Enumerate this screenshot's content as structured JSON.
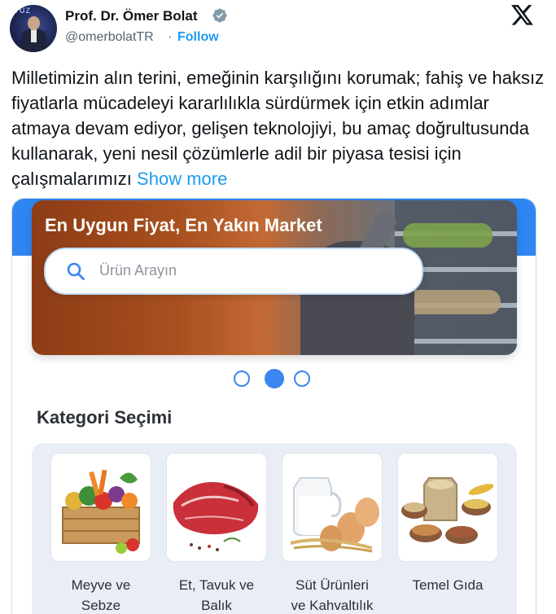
{
  "author": {
    "name": "Prof. Dr. Ömer Bolat",
    "handle": "@omerbolatTR",
    "separator": "·",
    "follow_label": "Follow",
    "avatar_text": "YÜZ"
  },
  "tweet": {
    "text": "Milletimizin alın terini, emeğinin karşılığını korumak; fahiş ve haksız fiyatlarla mücadeleyi kararlılıkla sürdürmek için etkin adımlar atmaya devam ediyor, gelişen teknolojiyi, bu amaç doğrultusunda kullanarak, yeni nesil çözümlerle adil bir piyasa tesisi için çalışmalarımızı",
    "show_more": "Show more"
  },
  "app": {
    "banner_title": "En Uygun Fiyat, En Yakın Market",
    "search_placeholder": "Ürün Arayın",
    "carousel_active_index": 1,
    "section_title": "Kategori Seçimi",
    "categories": [
      {
        "line1": "Meyve ve",
        "line2": "Sebze",
        "icon": "fruit-vegetable-crate-icon"
      },
      {
        "line1": "Et, Tavuk ve",
        "line2": "Balık",
        "icon": "meat-icon"
      },
      {
        "line1": "Süt Ürünleri",
        "line2": "ve Kahvaltılık",
        "icon": "milk-eggs-icon"
      },
      {
        "line1": "Temel Gıda",
        "line2": "",
        "icon": "grains-legumes-icon"
      }
    ]
  },
  "colors": {
    "link_blue": "#1d9bf0",
    "app_blue": "#3b86f0",
    "verified_gray": "#829aab"
  }
}
